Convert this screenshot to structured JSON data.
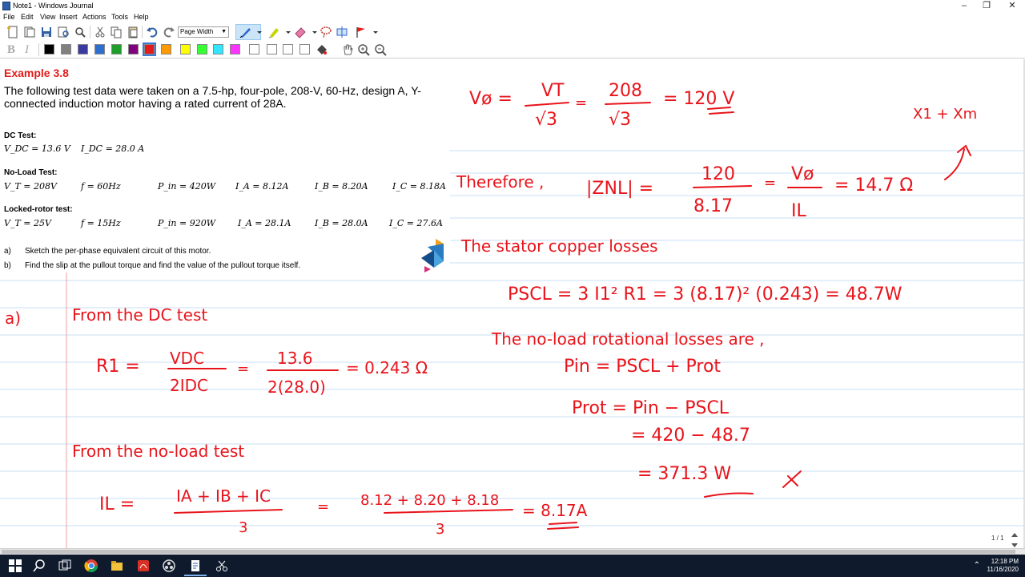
{
  "window": {
    "title": "Note1 - Windows Journal"
  },
  "menu": [
    "File",
    "Edit",
    "View",
    "Insert",
    "Actions",
    "Tools",
    "Help"
  ],
  "toolbar": {
    "zoom": "Page Width"
  },
  "colors": {
    "ink": "#e8141b",
    "title_red": "#e31b1b",
    "rule_blue": "#c7dff5",
    "margin_red": "#e8a0a0",
    "swatches": [
      "#000000",
      "#808080",
      "#3a3aa0",
      "#2c6fd1",
      "#1f9e2c",
      "#800080",
      "#e31b1b",
      "#ff9900",
      "#ffff00",
      "#33ff33",
      "#33e6ff",
      "#ff33ff",
      "#ffffff",
      "#ffffff",
      "#ffffff",
      "#ffffff"
    ]
  },
  "document": {
    "example_title": "Example 3.8",
    "intro": "The following test data were taken on a 7.5-hp, four-pole, 208-V, 60-Hz, design A, Y-connected induction motor having a rated current of 28A.",
    "dc_test": {
      "heading": "DC Test:",
      "vdc": "V_DC = 13.6 V",
      "idc": "I_DC = 28.0 A"
    },
    "no_load_test": {
      "heading": "No-Load Test:",
      "values": [
        "V_T = 208V",
        "f = 60Hz",
        "P_in = 420W",
        "I_A = 8.12A",
        "I_B = 8.20A",
        "I_C = 8.18A"
      ]
    },
    "locked_rotor_test": {
      "heading": "Locked-rotor test:",
      "values": [
        "V_T = 25V",
        "f = 15Hz",
        "P_in = 920W",
        "I_A = 28.1A",
        "I_B = 28.0A",
        "I_C = 27.6A"
      ]
    },
    "questions": [
      {
        "label": "a)",
        "text": "Sketch the per-phase equivalent circuit of this motor."
      },
      {
        "label": "b)",
        "text": "Find the slip at the pullout torque and find the value of the pullout torque itself."
      }
    ]
  },
  "handwriting": {
    "vphi_lhs": "Vø =",
    "vphi_num": "VT",
    "vphi_den": "√3",
    "vphi_num2": "208",
    "vphi_den2": "√3",
    "vphi_res": "= 120 V",
    "x1xm": "X1 + Xm",
    "therefore": "Therefore ,",
    "znl": "|ZNL| =",
    "znl_num": "120",
    "znl_den": "8.17",
    "znl_num2": "Vø",
    "znl_den2": "IL",
    "znl_res": "= 14.7 Ω",
    "stator_text": "The stator copper losses",
    "pscl_eq": "PSCL = 3 I1² R1 = 3 (8.17)² (0.243) = 48.7W",
    "noload_rot": "The no-load rotational losses are ,",
    "pin_eq": "Pin = PSCL + Prot",
    "prot_eq": "Prot = Pin − PSCL",
    "prot_sub": "= 420 − 48.7",
    "prot_res": "= 371.3 W",
    "part_a": "a)",
    "from_dc": "From the DC test",
    "r1_lhs": "R1 =",
    "r1_num": "VDC",
    "r1_den": "2IDC",
    "r1_num2": "13.6",
    "r1_den2": "2(28.0)",
    "r1_res": "= 0.243 Ω",
    "from_noload": "From the no-load test",
    "il_lhs": "IL =",
    "il_num": "IA + IB + IC",
    "il_den": "3",
    "il_num2": "8.12 + 8.20 + 8.18",
    "il_den2": "3",
    "il_res": "= 8.17A"
  },
  "status": {
    "pages": "1 / 1"
  },
  "taskbar": {
    "time": "12:18 PM",
    "date": "11/16/2020"
  }
}
